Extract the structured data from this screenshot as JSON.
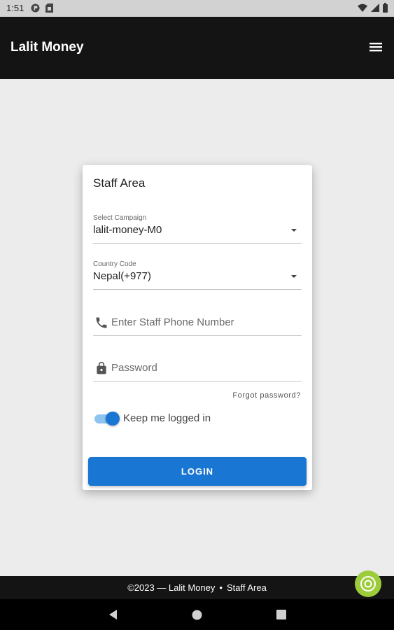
{
  "status_bar": {
    "time": "1:51"
  },
  "app": {
    "title": "Lalit Money"
  },
  "card": {
    "title": "Staff Area",
    "campaign": {
      "label": "Select Campaign",
      "value": "lalit-money-M0"
    },
    "country": {
      "label": "Country Code",
      "value": "Nepal(+977)"
    },
    "phone": {
      "placeholder": "Enter Staff Phone Number"
    },
    "password": {
      "placeholder": "Password"
    },
    "forgot_label": "Forgot password?",
    "keep_logged_in": {
      "label": "Keep me logged in",
      "checked": true
    },
    "login_label": "LOGIN"
  },
  "footer": {
    "copyright": "©2023 — Lalit Money",
    "separator": "•",
    "link": "Staff Area"
  },
  "colors": {
    "primary": "#1976d2",
    "appbar": "#141414",
    "fab": "#9ccc3c",
    "background": "#ececec"
  },
  "icons": [
    "menu-icon",
    "phone-icon",
    "lock-icon",
    "chevron-down-icon",
    "fab-icon",
    "back-icon",
    "home-icon",
    "recents-icon"
  ]
}
